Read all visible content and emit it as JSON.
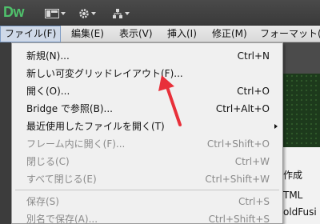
{
  "app": {
    "logo": "Dw"
  },
  "toolbar": {
    "buttons": [
      "layout-icon",
      "gear-icon",
      "site-icon"
    ]
  },
  "menubar": {
    "items": [
      "ファイル(F)",
      "編集(E)",
      "表示(V)",
      "挿入(I)",
      "修正(M)",
      "フォーマット("
    ],
    "active": "ファイル(F)"
  },
  "file_menu": {
    "items": [
      {
        "label": "新規(N)...",
        "shortcut": "Ctrl+N",
        "enabled": true
      },
      {
        "label": "新しい可変グリッドレイアウト(F)...",
        "shortcut": "",
        "enabled": true
      },
      {
        "label": "開く(O)...",
        "shortcut": "Ctrl+O",
        "enabled": true
      },
      {
        "label": "Bridge で参照(B)...",
        "shortcut": "Ctrl+Alt+O",
        "enabled": true
      },
      {
        "label": "最近使用したファイルを開く(T)",
        "shortcut": "",
        "enabled": true,
        "submenu": true
      },
      {
        "label": "フレーム内に開く(F)...",
        "shortcut": "Ctrl+Shift+O",
        "enabled": false
      },
      {
        "label": "閉じる(C)",
        "shortcut": "Ctrl+W",
        "enabled": false
      },
      {
        "label": "すべて閉じる(E)",
        "shortcut": "Ctrl+Shift+W",
        "enabled": false
      },
      {
        "label": "保存(S)",
        "shortcut": "Ctrl+S",
        "enabled": false
      },
      {
        "label": "別名で保存(A)...",
        "shortcut": "Ctrl+Shift+S",
        "enabled": false
      }
    ]
  },
  "background": {
    "text1": "作成",
    "text2": "TML",
    "text3": "oldFusi"
  },
  "colors": {
    "arrow": "#e8303a",
    "logo": "#4fc06b"
  }
}
